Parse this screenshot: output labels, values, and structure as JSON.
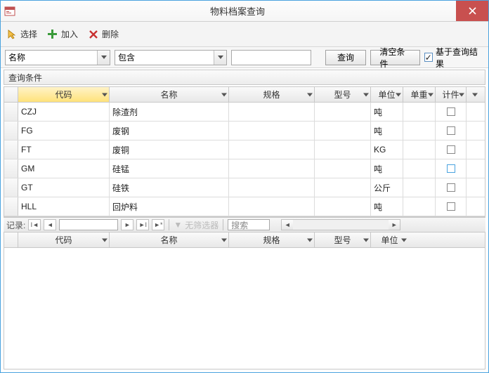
{
  "window": {
    "title": "物料档案查询"
  },
  "toolbar": {
    "select": "选择",
    "add": "加入",
    "delete": "删除"
  },
  "filter": {
    "field_value": "名称",
    "op_value": "包含",
    "text_value": "",
    "query_btn": "查询",
    "clear_btn": "清空条件",
    "based_chk": "基于查询结果",
    "based_checked": "✓"
  },
  "section_label": "查询条件",
  "grid1": {
    "cols": [
      "代码",
      "名称",
      "规格",
      "型号",
      "单位",
      "单重",
      "计件"
    ],
    "rows": [
      {
        "code": "CZJ",
        "name": "除渣剂",
        "spec": "",
        "model": "",
        "unit": "吨",
        "weight": "",
        "piece": false
      },
      {
        "code": "FG",
        "name": "废钢",
        "spec": "",
        "model": "",
        "unit": "吨",
        "weight": "",
        "piece": false
      },
      {
        "code": "FT",
        "name": "废铜",
        "spec": "",
        "model": "",
        "unit": "KG",
        "weight": "",
        "piece": false
      },
      {
        "code": "GM",
        "name": "硅锰",
        "spec": "",
        "model": "",
        "unit": "吨",
        "weight": "",
        "piece": false,
        "hl": true
      },
      {
        "code": "GT",
        "name": "硅铁",
        "spec": "",
        "model": "",
        "unit": "公斤",
        "weight": "",
        "piece": false
      },
      {
        "code": "HLL",
        "name": "回炉料",
        "spec": "",
        "model": "",
        "unit": "吨",
        "weight": "",
        "piece": false
      }
    ]
  },
  "nav": {
    "label": "记录:",
    "nofilter": "无筛选器",
    "search_ph": "搜索"
  },
  "grid2": {
    "cols": [
      "代码",
      "名称",
      "规格",
      "型号",
      "单位"
    ]
  }
}
